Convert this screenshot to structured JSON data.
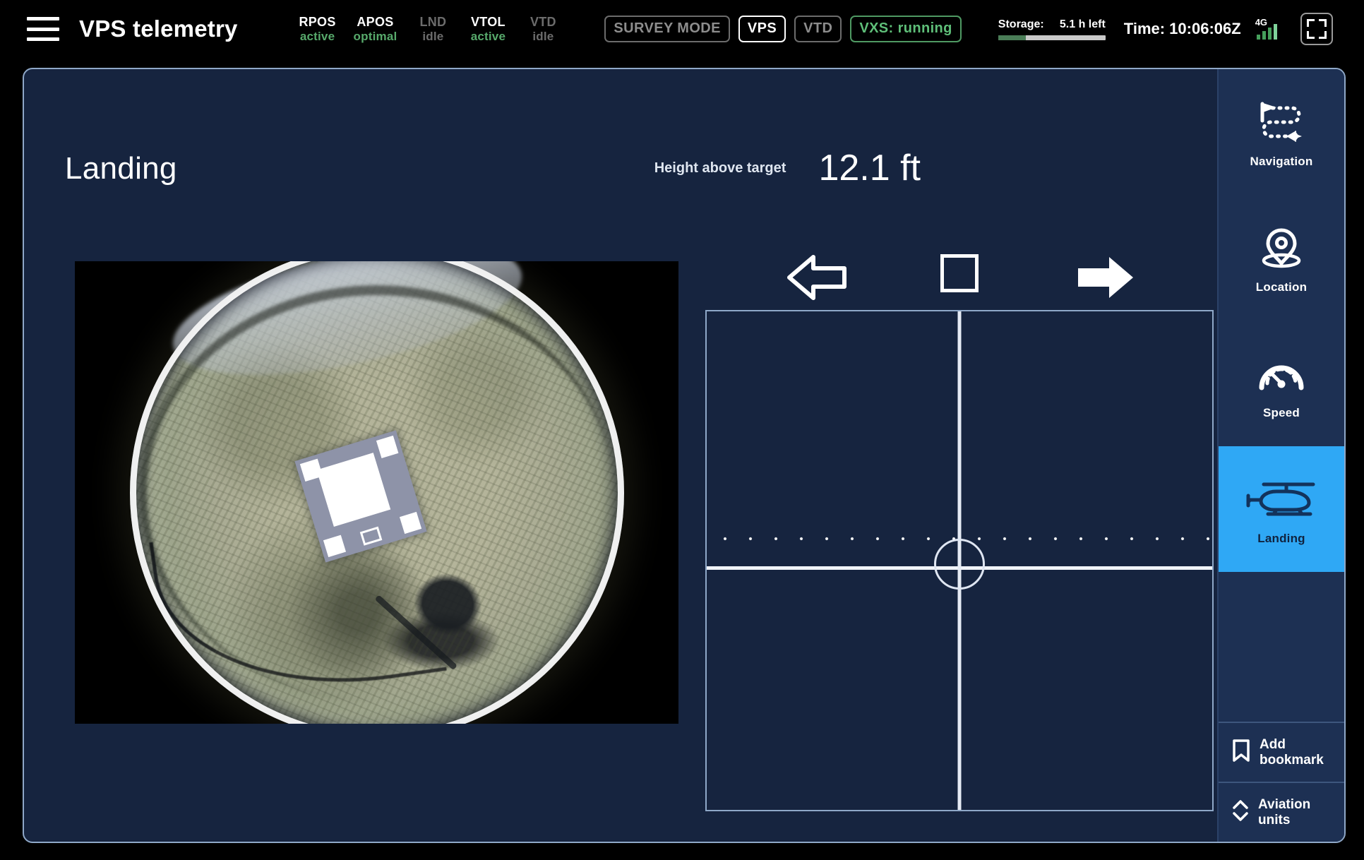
{
  "topbar": {
    "menu_icon": "hamburger-menu-icon",
    "app_title": "VPS telemetry",
    "systems": [
      {
        "code": "RPOS",
        "state": "active",
        "enabled": true
      },
      {
        "code": "APOS",
        "state": "optimal",
        "enabled": true
      },
      {
        "code": "LND",
        "state": "idle",
        "enabled": false
      },
      {
        "code": "VTOL",
        "state": "active",
        "enabled": true
      },
      {
        "code": "VTD",
        "state": "idle",
        "enabled": false
      }
    ],
    "chips": [
      {
        "label": "SURVEY MODE",
        "style": "dim"
      },
      {
        "label": "VPS",
        "style": "white"
      },
      {
        "label": "VTD",
        "style": "dim"
      },
      {
        "label": "VXS: running",
        "style": "green"
      }
    ],
    "storage": {
      "label": "Storage:",
      "value": "5.1 h left",
      "percent": 26
    },
    "clock": "Time: 10:06:06Z",
    "signal": {
      "network": "4G",
      "bars": 4,
      "icon": "signal-bars-icon"
    },
    "fullscreen_icon": "fullscreen-icon"
  },
  "main": {
    "page_title": "Landing",
    "height": {
      "caption": "Height above target",
      "value": "12.1 ft"
    },
    "camera": {
      "icon": "fisheye-camera-view",
      "alt": "downward fisheye camera view of landing pad"
    },
    "guidance": {
      "cues": [
        {
          "name": "move-left-cue",
          "icon": "arrow-left-outline-icon",
          "filled": false
        },
        {
          "name": "centered-cue",
          "icon": "square-outline-icon",
          "filled": false
        },
        {
          "name": "move-right-cue",
          "icon": "arrow-right-solid-icon",
          "filled": true
        }
      ]
    }
  },
  "rail": {
    "items": [
      {
        "label": "Navigation",
        "icon": "route-flag-plane-icon",
        "active": false
      },
      {
        "label": "Location",
        "icon": "map-pin-icon",
        "active": false
      },
      {
        "label": "Speed",
        "icon": "speedometer-icon",
        "active": false
      },
      {
        "label": "Landing",
        "icon": "helicopter-icon",
        "active": true
      }
    ],
    "footer": [
      {
        "label": "Add\nbookmark",
        "line1": "Add",
        "line2": "bookmark",
        "icon": "bookmark-icon"
      },
      {
        "label": "Aviation\nunits",
        "line1": "Aviation",
        "line2": "units",
        "icon": "chevron-updown-icon"
      }
    ]
  },
  "colors": {
    "accent": "#2fa8f5",
    "panel_bg": "#16243f",
    "rail_bg": "#1d3053",
    "status_ok": "#57a96b",
    "status_idle": "#6c6c6c",
    "topbar_bg": "#000000"
  }
}
